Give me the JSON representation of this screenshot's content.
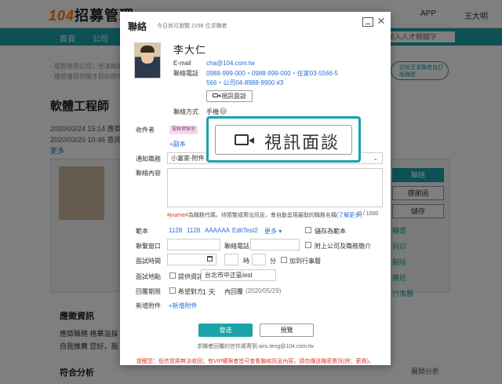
{
  "background": {
    "logo_number": "104",
    "logo_text": "招募管理",
    "app_label": "APP",
    "user_name": "王大明",
    "nav": [
      "首頁",
      "公司"
    ],
    "search_placeholder": "輸入人才關鍵字",
    "notes": [
      "- 履歷使用公司：老演格爾莊",
      "- 履歷僅提供徵才目的使用"
    ],
    "job_title": "軟體工程師",
    "dates": [
      "2020/03/24 15:14 應徵",
      "2020/03/20 10:46 查詢人"
    ],
    "more": "更多",
    "promo": "切換至求職者自訂版職歷",
    "side_buttons": [
      "聯絡",
      "感謝函",
      "儲存"
    ],
    "side_links": [
      "轉寄",
      "列印",
      "刪除",
      "備註",
      "行事曆"
    ],
    "section_apply": "應徵資訊",
    "apply_rows": [
      "應徵職務  格華溢採",
      "自我推薦  您好，我"
    ],
    "section_match": "符合分析",
    "match_more": "展開分析"
  },
  "modal": {
    "title": "聯絡",
    "quota": "今日尚可瀏覽 2198 位求職者",
    "candidate": {
      "name": "李大仁",
      "email_label": "E-mail",
      "email": "cha@104.com.tw",
      "phone_label": "聯絡電話",
      "phone_line1": "0988-999-000・0988-999-000・住家03-5566-5",
      "phone_line2": "566・公司04-8988-9900 #3",
      "video_button": "視訊面談",
      "contact_method_label": "聯絡方式",
      "contact_method_value": "手機",
      "help_icon_text": "?"
    },
    "recipient_label": "收件者",
    "recipient_tag": "電聯實驗室",
    "add_copy": "+副本",
    "notify_label": "通知職務",
    "notify_value": "小富家-附件...",
    "content_label": "聯絡內容",
    "hint_prefix": "#jname#",
    "hint_text": "為職務代碼，待預覽或寄出訊息，會自動呈現最取的職務名稱",
    "hint_link": "(了解更多)",
    "char_count": "0 / 1000",
    "template_label": "範本",
    "templates": [
      "1128",
      "1128",
      "AAAAAA",
      "EditTest2"
    ],
    "templates_more": "更多",
    "save_template": "儲存為範本",
    "contact_window_label": "聯繫窗口",
    "contact_phone_label": "聯絡電話",
    "attach_company": "附上公司及職務簡介",
    "interview_time_label": "面試時間",
    "hour_unit": "時",
    "minute_unit": "分",
    "add_calendar": "加到行事曆",
    "interview_place_label": "面試地點",
    "provide_info": "提供資訊",
    "place_value": "台北市中正區test",
    "reply_deadline_label": "回覆期限",
    "hope_reply": "希望對方",
    "days_value": "1 天",
    "reply_within": "內回覆",
    "reply_date": "(2020/05/29)",
    "attachments_label": "新增附件",
    "add_attachment": "+新增附件",
    "send_button": "發送",
    "preview_button": "預覽",
    "footer_email": "求職者回覆的信件將寄到 airu.teng@104.com.tw",
    "footer_warning": "提醒您：低信發將無法收回；有VIP權限者皆可查看聯絡訊息內容，請勿傳送機密資訊(例：薪資)。",
    "close_icon": "×"
  },
  "callout": {
    "label": "視訊面談"
  },
  "colors": {
    "accent": "#1aa3a8",
    "link": "#2a6fd6",
    "warning": "#d93a2b"
  },
  "icons": [
    "close-icon",
    "minimize-icon",
    "video-camera-icon",
    "calendar-icon",
    "help-icon"
  ]
}
